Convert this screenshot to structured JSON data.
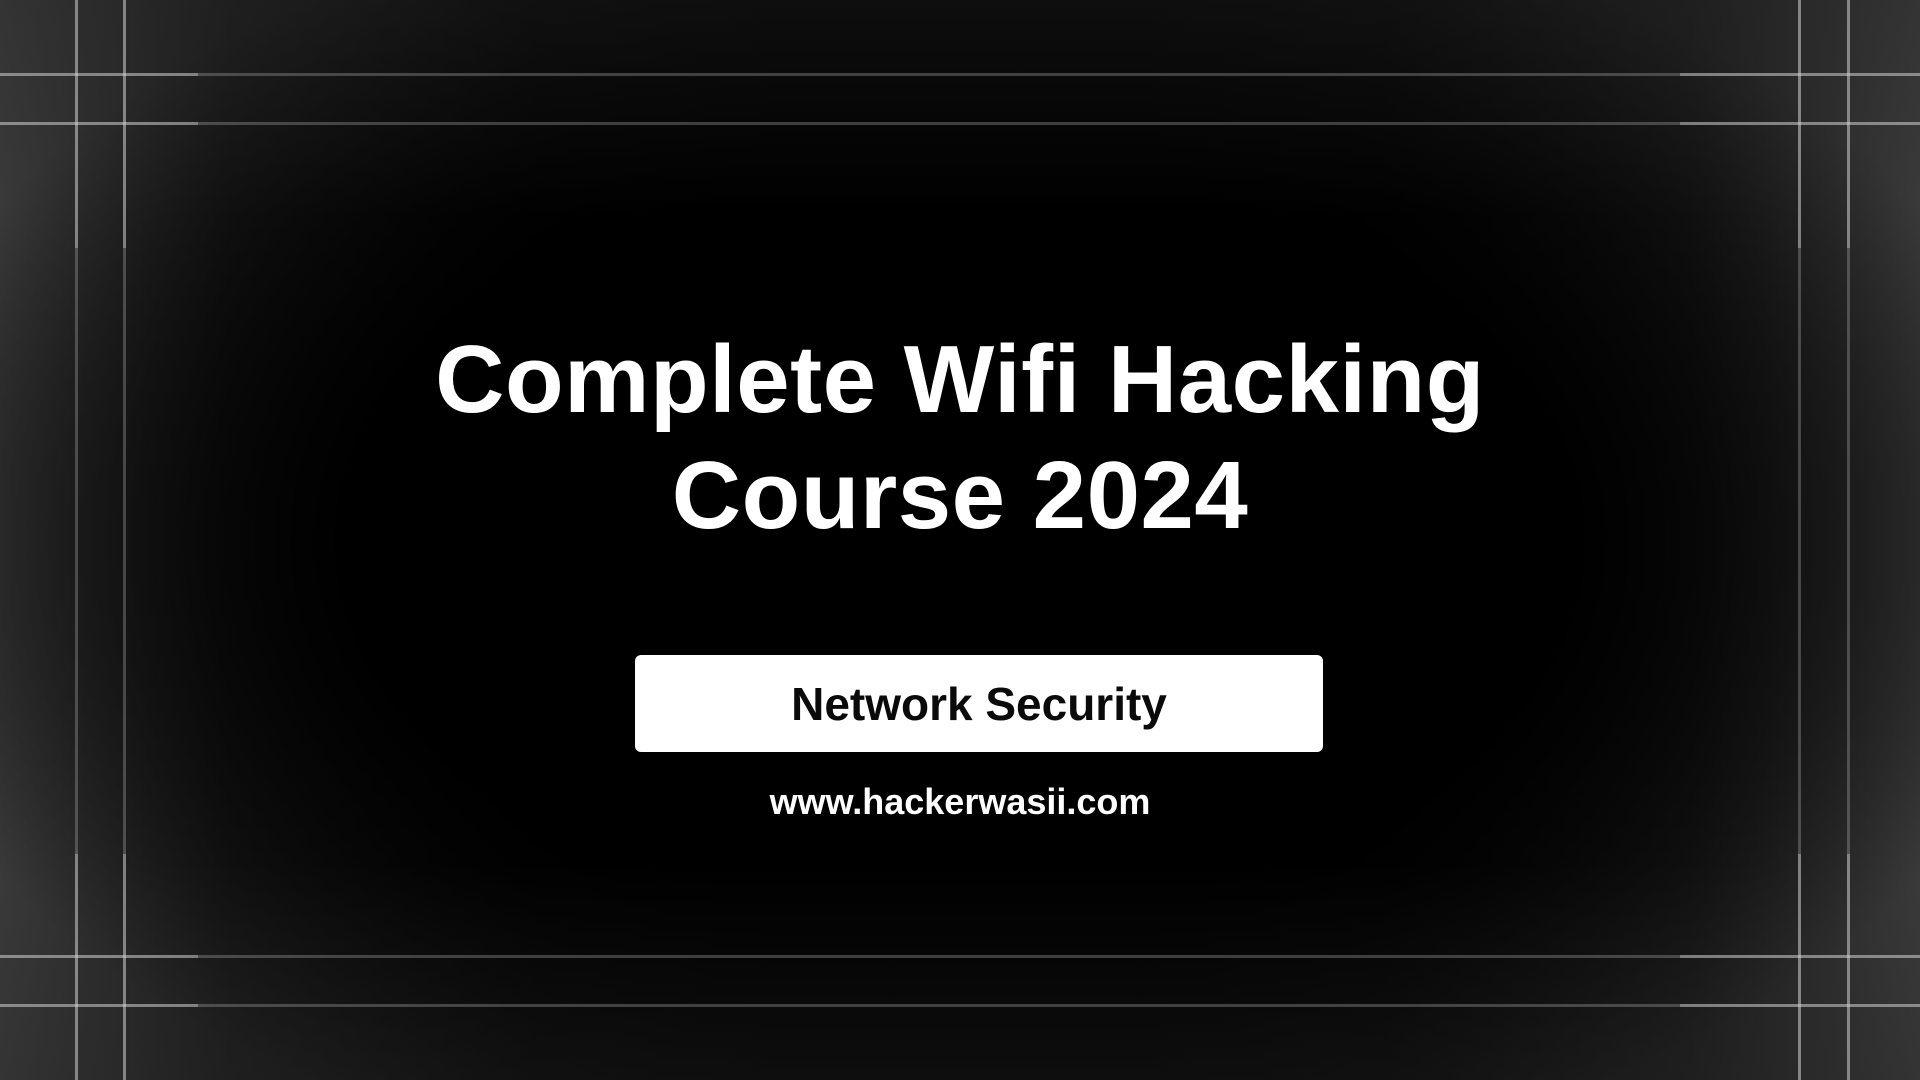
{
  "title": {
    "line1": "Complete Wifi Hacking",
    "line2": "Course 2024"
  },
  "badge": {
    "label": "Network Security"
  },
  "footer": {
    "url": "www.hackerwasii.com"
  },
  "colors": {
    "background": "#000000",
    "text": "#ffffff",
    "badge_background": "#ffffff",
    "badge_text": "#0a0a0a",
    "grid_lines": "#d2d2d2"
  }
}
